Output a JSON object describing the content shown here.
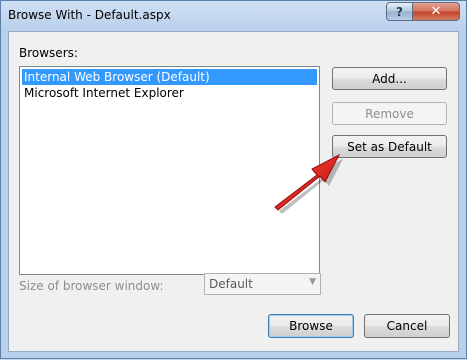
{
  "window": {
    "title": "Browse With - Default.aspx",
    "help_glyph": "?",
    "close_glyph": "✕"
  },
  "browsers": {
    "label": "Browsers:",
    "items": [
      {
        "label": "Internal Web Browser (Default)",
        "selected": true
      },
      {
        "label": "Microsoft Internet Explorer",
        "selected": false
      }
    ]
  },
  "buttons": {
    "add": "Add...",
    "remove": "Remove",
    "set_default": "Set as Default",
    "browse": "Browse",
    "cancel": "Cancel"
  },
  "size": {
    "label": "Size of browser window:",
    "value": "Default"
  },
  "colors": {
    "selection": "#3399ff",
    "annotation_arrow": "#e01818"
  },
  "icons": {
    "dropdown": "chevron-down-icon",
    "annotation": "red-arrow-icon"
  }
}
